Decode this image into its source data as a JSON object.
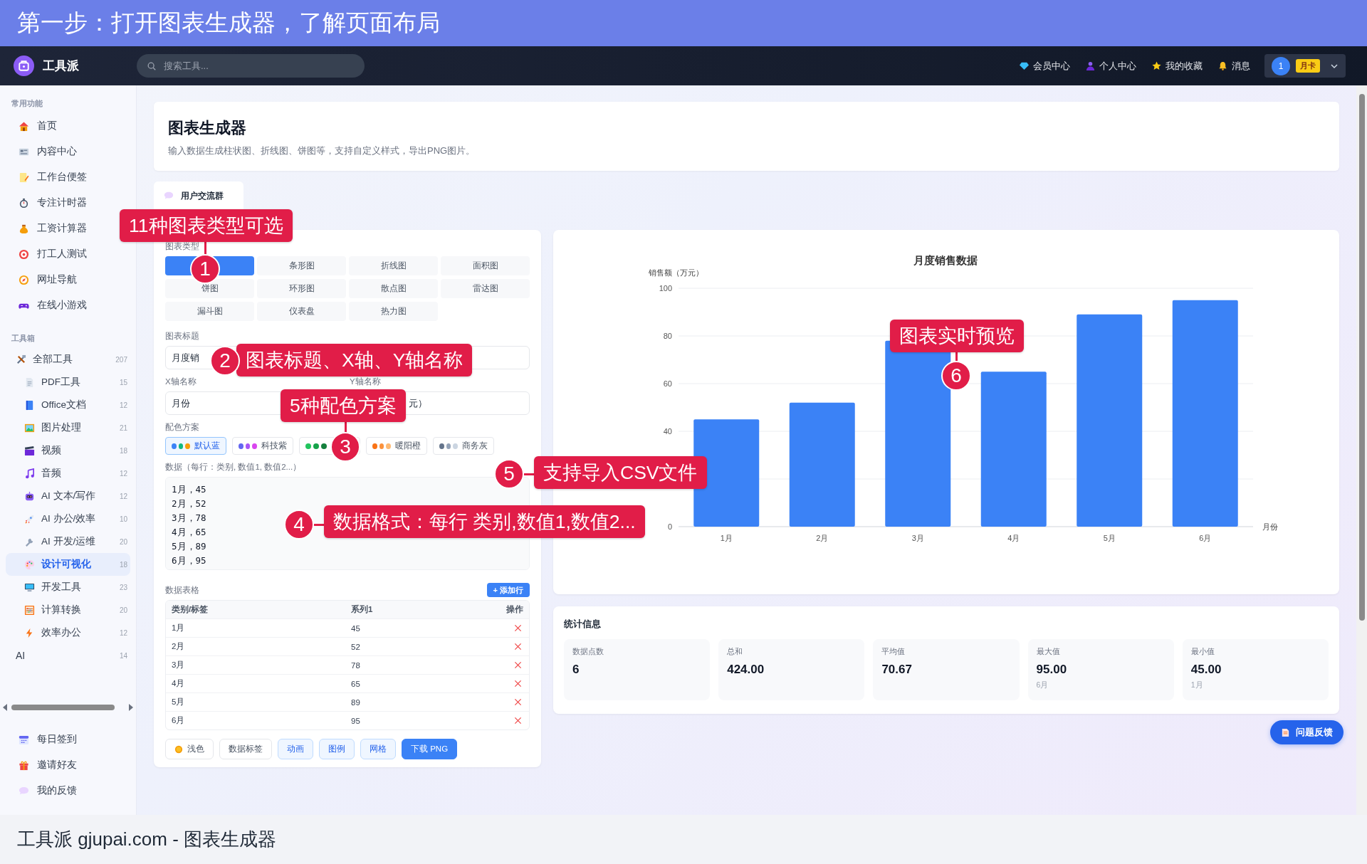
{
  "banner": {
    "title": "第一步：打开图表生成器，了解页面布局"
  },
  "navbar": {
    "brand": "工具派",
    "search": {
      "placeholder": "搜索工具..."
    },
    "links": [
      {
        "label": "会员中心"
      },
      {
        "label": "个人中心"
      },
      {
        "label": "我的收藏"
      },
      {
        "label": "消息"
      }
    ],
    "user": {
      "avatar": "1",
      "badge": "月卡"
    }
  },
  "sidebar": {
    "sections": [
      {
        "title": "常用功能",
        "items": [
          {
            "label": "首页",
            "selected": false
          },
          {
            "label": "内容中心",
            "selected": false
          },
          {
            "label": "工作台便签",
            "selected": false
          },
          {
            "label": "专注计时器",
            "selected": false
          },
          {
            "label": "工资计算器",
            "selected": false
          },
          {
            "label": "打工人测试",
            "selected": false
          },
          {
            "label": "网址导航",
            "selected": false
          },
          {
            "label": "在线小游戏",
            "selected": false
          }
        ]
      },
      {
        "title": "工具箱",
        "items": [
          {
            "label": "全部工具",
            "count": "207",
            "selected": false,
            "children": [
              {
                "label": "PDF工具",
                "count": "15",
                "selected": false
              },
              {
                "label": "Office文档",
                "count": "12",
                "selected": false
              },
              {
                "label": "图片处理",
                "count": "21",
                "selected": false
              },
              {
                "label": "视频",
                "count": "18",
                "selected": false
              },
              {
                "label": "音频",
                "count": "12",
                "selected": false
              },
              {
                "label": "AI 文本/写作",
                "count": "12",
                "selected": false
              },
              {
                "label": "AI 办公/效率",
                "count": "10",
                "selected": false
              },
              {
                "label": "AI 开发/运维",
                "count": "20",
                "selected": false
              },
              {
                "label": "设计可视化",
                "count": "18",
                "selected": true
              },
              {
                "label": "开发工具",
                "count": "23",
                "selected": false
              },
              {
                "label": "计算转换",
                "count": "20",
                "selected": false
              },
              {
                "label": "效率办公",
                "count": "12",
                "selected": false
              }
            ]
          },
          {
            "label": "AI",
            "count": "14",
            "selected": false
          }
        ]
      }
    ],
    "footer_items": [
      {
        "label": "每日签到"
      },
      {
        "label": "邀请好友"
      },
      {
        "label": "我的反馈"
      }
    ]
  },
  "header": {
    "title": "图表生成器",
    "subtitle": "输入数据生成柱状图、折线图、饼图等，支持自定义样式，导出PNG图片。"
  },
  "group_tab": {
    "label": "用户交流群"
  },
  "editor": {
    "chart_type_label": "图表类型",
    "chart_types": [
      {
        "selected": true
      },
      {
        "label": "条形图",
        "selected": false
      },
      {
        "label": "折线图",
        "selected": false
      },
      {
        "label": "面积图",
        "selected": false
      },
      {
        "label": "饼图",
        "selected": false
      },
      {
        "label": "环形图",
        "selected": false
      },
      {
        "label": "散点图",
        "selected": false
      },
      {
        "label": "雷达图",
        "selected": false
      },
      {
        "label": "漏斗图",
        "selected": false
      },
      {
        "label": "仪表盘",
        "selected": false
      },
      {
        "label": "热力图",
        "selected": false
      }
    ],
    "title_field": {
      "label": "图表标题",
      "value": "月度销"
    },
    "axis_fields": [
      {
        "label": "X轴名称",
        "value": "月份"
      },
      {
        "label": "Y轴名称",
        "value": "元）"
      }
    ],
    "palette_label": "配色方案",
    "palettes": [
      {
        "label": "默认蓝",
        "selected": true,
        "dots": [
          {
            "color": "#3b82f6"
          },
          {
            "color": "#10b981"
          },
          {
            "color": "#f59e0b"
          }
        ]
      },
      {
        "label": "科技紫",
        "selected": false,
        "dots": [
          {
            "color": "#6366f1"
          },
          {
            "color": "#a855f7"
          },
          {
            "color": "#d946ef"
          }
        ]
      },
      {
        "selected": false,
        "dots": [
          {
            "color": "#22c55e"
          },
          {
            "color": "#16a34a"
          },
          {
            "color": "#15803d"
          }
        ]
      },
      {
        "label": "暖阳橙",
        "selected": false,
        "dots": [
          {
            "color": "#f97316"
          },
          {
            "color": "#fb923c"
          },
          {
            "color": "#fdba74"
          }
        ]
      },
      {
        "label": "商务灰",
        "selected": false,
        "dots": [
          {
            "color": "#64748b"
          },
          {
            "color": "#94a3b8"
          },
          {
            "color": "#cbd5e1"
          }
        ]
      }
    ],
    "data_label": "数据（每行：类别, 数值1, 数值2...）",
    "data_text": "1月，45\n2月，52\n3月，78\n4月，65\n5月，89\n6月，95",
    "table_label": "数据表格",
    "add_row": "+ 添加行",
    "table": {
      "columns": [
        "类别/标签",
        "系列1",
        "操作"
      ],
      "rows": [
        {
          "category": "1月",
          "value": "45"
        },
        {
          "category": "2月",
          "value": "52"
        },
        {
          "category": "3月",
          "value": "78"
        },
        {
          "category": "4月",
          "value": "65"
        },
        {
          "category": "5月",
          "value": "89"
        },
        {
          "category": "6月",
          "value": "95"
        }
      ]
    },
    "options": [
      {
        "kind": "theme",
        "label": "浅色",
        "on": false
      },
      {
        "kind": "toggle",
        "label": "数据标签",
        "on": false
      },
      {
        "kind": "toggle",
        "label": "动画",
        "on": true
      },
      {
        "kind": "toggle",
        "label": "图例",
        "on": true
      },
      {
        "kind": "toggle",
        "label": "网格",
        "on": true
      },
      {
        "kind": "download",
        "label": "下载 PNG"
      }
    ]
  },
  "chart": {
    "chart_data": {
      "type": "bar",
      "title": "月度销售数据",
      "xlabel": "月份",
      "ylabel": "销售额（万元）",
      "categories": [
        "1月",
        "2月",
        "3月",
        "4月",
        "5月",
        "6月"
      ],
      "values": [
        45,
        52,
        78,
        65,
        89,
        95
      ],
      "ylim": [
        0,
        100
      ],
      "grid": true,
      "yticks": [
        0,
        40,
        60,
        80,
        100
      ]
    }
  },
  "stats": {
    "title": "统计信息",
    "items": [
      {
        "label": "数据点数",
        "value": "6"
      },
      {
        "label": "总和",
        "value": "424.00"
      },
      {
        "label": "平均值",
        "value": "70.67"
      },
      {
        "label": "最大值",
        "value": "95.00",
        "sub": "6月"
      },
      {
        "label": "最小值",
        "value": "45.00",
        "sub": "1月"
      }
    ]
  },
  "feedback_button": {
    "label": "问题反馈"
  },
  "caption": "工具派 gjupai.com - 图表生成器",
  "annotations": [
    {
      "number": "1",
      "label": "11种图表类型可选"
    },
    {
      "number": "2",
      "label": "图表标题、X轴、Y轴名称"
    },
    {
      "number": "3",
      "label": "5种配色方案"
    },
    {
      "number": "4",
      "label": "数据格式：每行 类别,数值1,数值2..."
    },
    {
      "number": "5",
      "label": "支持导入CSV文件"
    },
    {
      "number": "6",
      "label": "图表实时预览"
    }
  ]
}
